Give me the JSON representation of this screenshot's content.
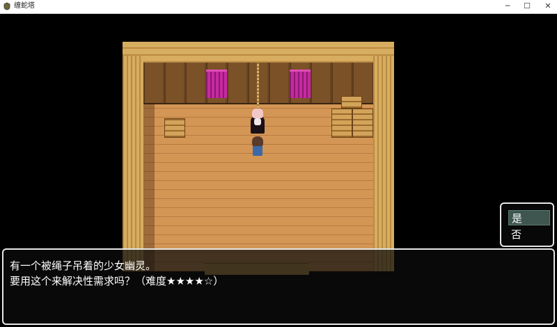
{
  "window": {
    "title": "缠蛇塔",
    "min_glyph": "─",
    "max_glyph": "☐",
    "close_glyph": "✕"
  },
  "message": {
    "line1": "有一个被绳子吊着的少女幽灵。",
    "line2": "要用这个来解决性需求吗？（难度★★★★☆）"
  },
  "choices": {
    "yes": "是",
    "no": "否",
    "selected": "yes"
  },
  "colors": {
    "curtain": "#c52aa0",
    "choice_highlight": "#3e5550"
  }
}
